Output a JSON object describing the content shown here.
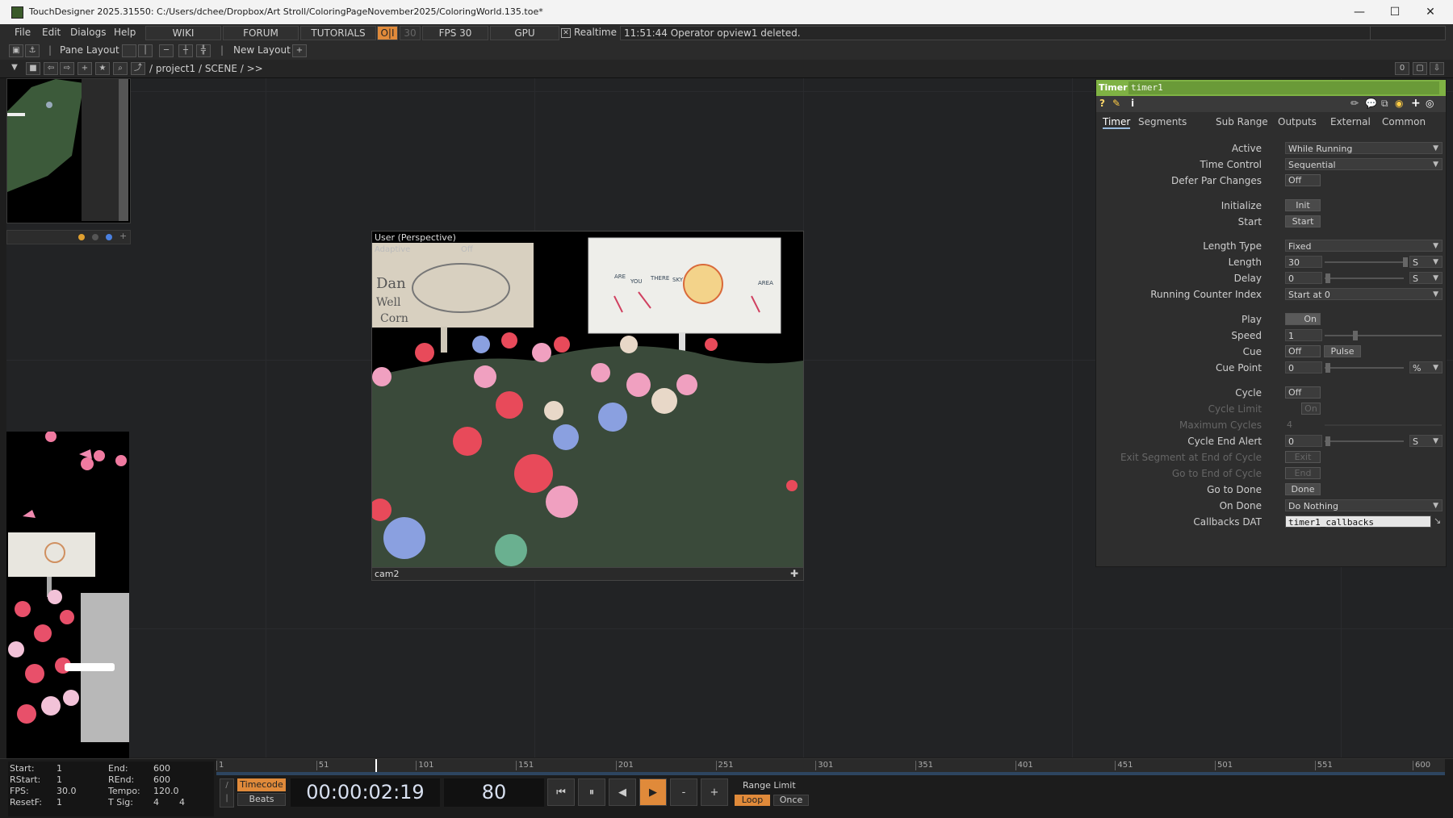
{
  "window": {
    "title": "TouchDesigner 2025.31550: C:/Users/dchee/Dropbox/Art Stroll/ColoringPageNovember2025/ColoringWorld.135.toe*",
    "minimize": "—",
    "maximize": "☐",
    "close": "✕"
  },
  "menu": {
    "items": [
      "File",
      "Edit",
      "Dialogs",
      "Help"
    ],
    "wiki": "WIKI",
    "forum": "FORUM",
    "tutorials": "TUTORIALS",
    "oi": "O|I",
    "thirty": "30",
    "fps": "FPS  30",
    "gpu": "GPU",
    "realtime": "Realtime",
    "log": "11:51:44 Operator opview1 deleted."
  },
  "layoutbar": {
    "pane_layout": "Pane Layout",
    "new_layout": "New Layout"
  },
  "pathbar": {
    "path": "/ project1 / SCENE / >>",
    "counter": "0"
  },
  "viewer": {
    "overlay_line1": "User (Perspective)",
    "overlay_line2": "Adaptive",
    "overlay_line3": "Off",
    "camera": "cam2",
    "billboard_left_text": [
      "Dan",
      "Well",
      "Corn"
    ],
    "billboard_right_text": [
      "ARE",
      "YOU",
      "THERE",
      "SKY",
      "AREA"
    ]
  },
  "params": {
    "op_type": "Timer",
    "op_name": "timer1",
    "tabs": [
      "Timer",
      "Segments",
      "Sub Range",
      "Outputs",
      "External",
      "Common"
    ],
    "rows": {
      "active": {
        "label": "Active",
        "value": "While Running"
      },
      "time_control": {
        "label": "Time Control",
        "value": "Sequential"
      },
      "defer": {
        "label": "Defer Par Changes",
        "value": "Off"
      },
      "initialize": {
        "label": "Initialize",
        "value": "Init"
      },
      "start": {
        "label": "Start",
        "value": "Start"
      },
      "length_type": {
        "label": "Length Type",
        "value": "Fixed"
      },
      "length": {
        "label": "Length",
        "value": "30",
        "unit": "S"
      },
      "delay": {
        "label": "Delay",
        "value": "0",
        "unit": "S"
      },
      "running_counter": {
        "label": "Running Counter Index",
        "value": "Start at 0"
      },
      "play": {
        "label": "Play",
        "value": "On"
      },
      "speed": {
        "label": "Speed",
        "value": "1"
      },
      "cue": {
        "label": "Cue",
        "value": "Off",
        "pulse": "Pulse"
      },
      "cue_point": {
        "label": "Cue Point",
        "value": "0",
        "unit": "%"
      },
      "cycle": {
        "label": "Cycle",
        "value": "Off"
      },
      "cycle_limit": {
        "label": "Cycle Limit",
        "value": "On"
      },
      "max_cycles": {
        "label": "Maximum Cycles",
        "value": "4"
      },
      "cycle_end_alert": {
        "label": "Cycle End Alert",
        "value": "0",
        "unit": "S"
      },
      "exit_segment": {
        "label": "Exit Segment at End of Cycle",
        "value": "Exit"
      },
      "go_end_cycle": {
        "label": "Go to End of Cycle",
        "value": "End"
      },
      "go_done": {
        "label": "Go to Done",
        "value": "Done"
      },
      "on_done": {
        "label": "On Done",
        "value": "Do Nothing"
      },
      "callbacks": {
        "label": "Callbacks DAT",
        "value": "timer1_callbacks"
      }
    }
  },
  "timeline": {
    "start_label": "Start:",
    "start": "1",
    "end_label": "End:",
    "end": "600",
    "rstart_label": "RStart:",
    "rstart": "1",
    "rend_label": "REnd:",
    "rend": "600",
    "fps_label": "FPS:",
    "fps": "30.0",
    "tempo_label": "Tempo:",
    "tempo": "120.0",
    "resetf_label": "ResetF:",
    "resetf": "1",
    "tsig_label": "T Sig:",
    "tsig_a": "4",
    "tsig_b": "4",
    "timecode": "Timecode",
    "beats": "Beats",
    "time": "00:00:02:19",
    "frame": "80",
    "range_limit": "Range Limit",
    "loop": "Loop",
    "once": "Once",
    "ticks": [
      "1",
      "51",
      "101",
      "151",
      "201",
      "251",
      "301",
      "351",
      "401",
      "451",
      "501",
      "551",
      "600"
    ],
    "playhead_fraction": 0.133
  },
  "colors": {
    "accent": "#e08a3a",
    "op_header": "#7fb244"
  }
}
